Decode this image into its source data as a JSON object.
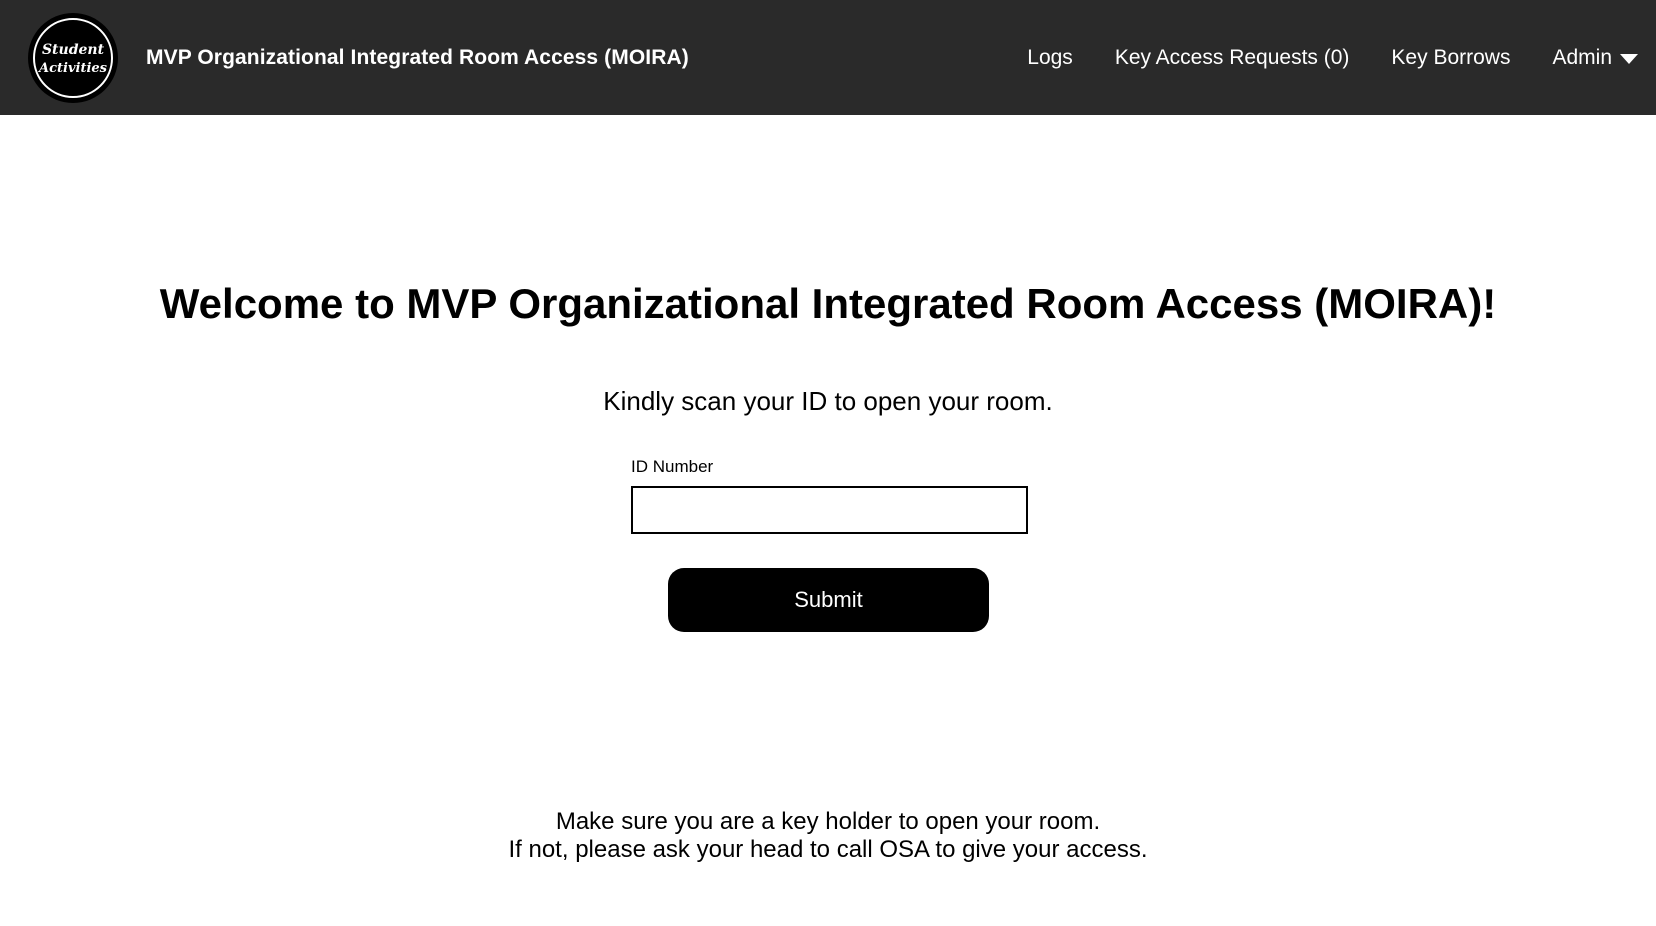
{
  "header": {
    "logo_text_line1": "Student",
    "logo_text_line2": "Activities",
    "title": "MVP Organizational Integrated Room Access (MOIRA)",
    "nav": {
      "logs": "Logs",
      "key_access_requests": "Key Access Requests (0)",
      "key_borrows": "Key Borrows",
      "admin": "Admin"
    }
  },
  "main": {
    "welcome_prefix": "Welcome to ",
    "welcome_app_name": "MVP Organizational Integrated Room Access (MOIRA)!",
    "instruction": "Kindly scan your ID to open your room.",
    "id_label": "ID Number",
    "id_value": "",
    "submit_label": "Submit",
    "note_line1": "Make sure you are a key holder to open your room.",
    "note_line2": "If not, please ask your head to call OSA to give your access."
  },
  "colors": {
    "navbar_bg": "#2a2a2a",
    "button_bg": "#000000",
    "page_bg": "#ffffff"
  }
}
